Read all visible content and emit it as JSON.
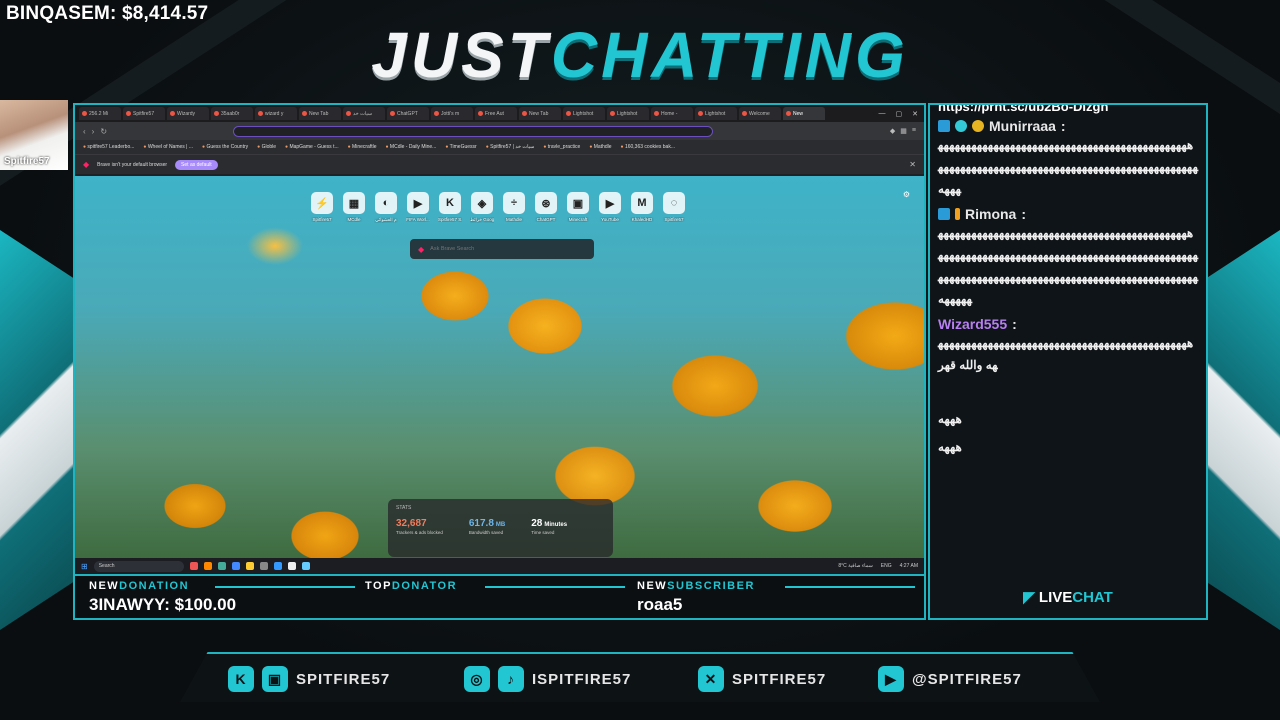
{
  "overlay": {
    "balance": "BINQASEM: $8,414.57",
    "headline_a": "JUST",
    "headline_b": "CHATTING",
    "cam_name": "Spitfire57"
  },
  "browser": {
    "tabs": [
      "256.2 Mi",
      "Spitfire57",
      "Wizardy",
      "35aab0r",
      "wizard y",
      "New Tab",
      "سيات خد",
      "ChatGPT",
      "Jotti's m",
      "Free Aut",
      "New Tab",
      "Lightshot",
      "Lightshot",
      "Home -",
      "Lightshot",
      "Welcome",
      "New"
    ],
    "bookmarks": [
      "spitfire57 Leaderbo...",
      "Wheel of Names | ...",
      "Guess the Country",
      "Globle",
      "MapGame - Guess t...",
      "Minecraftle",
      "MCdle - Daily Mine...",
      "TimeGuessr",
      "Spitfire57 | سيات خد",
      "travle_practice",
      "Mathdle",
      "160,363 cookies bak..."
    ],
    "infobar_text": "Brave isn't your default browser",
    "infobar_button": "Set as default",
    "shortcuts": [
      {
        "glyph": "⚡",
        "label": "Spitfire57"
      },
      {
        "glyph": "▦",
        "label": "MCdle"
      },
      {
        "glyph": "◐",
        "label": "م العشوائي"
      },
      {
        "glyph": "▶",
        "label": "FIFA Worl..."
      },
      {
        "glyph": "K",
        "label": "Spitfire57 S..."
      },
      {
        "glyph": "◈",
        "label": "خرائط Google"
      },
      {
        "glyph": "÷",
        "label": "Mathdle"
      },
      {
        "glyph": "⊛",
        "label": "ChatGPT"
      },
      {
        "glyph": "▣",
        "label": "Minecraft"
      },
      {
        "glyph": "▶",
        "label": "YouTube"
      },
      {
        "glyph": "M",
        "label": "KhaledHD"
      },
      {
        "glyph": "◌",
        "label": "Spitfire57"
      }
    ],
    "search_placeholder": "Ask Brave Search",
    "stats": {
      "title": "STATS",
      "trackers_value": "32,687",
      "trackers_label": "Trackers & ads blocked",
      "bandwidth_value": "617.8",
      "bandwidth_unit": "MB",
      "bandwidth_label": "Bandwidth saved",
      "time_value": "28",
      "time_unit": "Minutes",
      "time_label": "Time saved"
    },
    "taskbar": {
      "search": "Search",
      "weather": "8°C سماء صافية",
      "lang": "ENG",
      "time": "4:27 AM"
    }
  },
  "chat": {
    "top_text": "https://prnt.sc/ub2Bo-DIzgh",
    "messages": [
      {
        "user": "Munirraaa",
        "user_color": "#e8e8e8",
        "body": "ههههههههههههههههههههههههههههههههههههههههههههههههههههههههههههههههههههههههههههههههههههههههههههههههه"
      },
      {
        "user": "Rimona",
        "user_color": "#e8e8e8",
        "body": "هههههههههههههههههههههههههههههههههههههههههههههههههههههههههههههههههههههههههههههههههههههههههههههههههههههههههههههههههههههههههههههههههههههههههههههههههه"
      },
      {
        "user": "Wizard555",
        "user_color": "#b77ff2",
        "body": "هههههههههههههههههههههههههههههههههههههههههههههههه والله قهر"
      },
      {
        "user": "",
        "user_color": "#e8e8e8",
        "body": "هههه"
      },
      {
        "user": "",
        "user_color": "#e8e8e8",
        "body": "هههه"
      }
    ],
    "livechat_a": "LIVE",
    "livechat_b": "CHAT"
  },
  "strip": {
    "new_donation_a": "NEW",
    "new_donation_b": "DONATION",
    "donation_value": "3INAWYY: $100.00",
    "top_donator_a": "TOP",
    "top_donator_b": "DONATOR",
    "new_sub_a": "NEW",
    "new_sub_b": "SUBSCRIBER",
    "subscriber_value": "roaa5"
  },
  "social": {
    "kick_twitch": "SPITFIRE57",
    "instagram_tiktok": "ISPITFIRE57",
    "x": "SPITFIRE57",
    "youtube": "@SPITFIRE57"
  },
  "colors": {
    "accent": "#22c6d2",
    "frame": "#1fb5c0",
    "chat_bg": "#0f1418"
  }
}
